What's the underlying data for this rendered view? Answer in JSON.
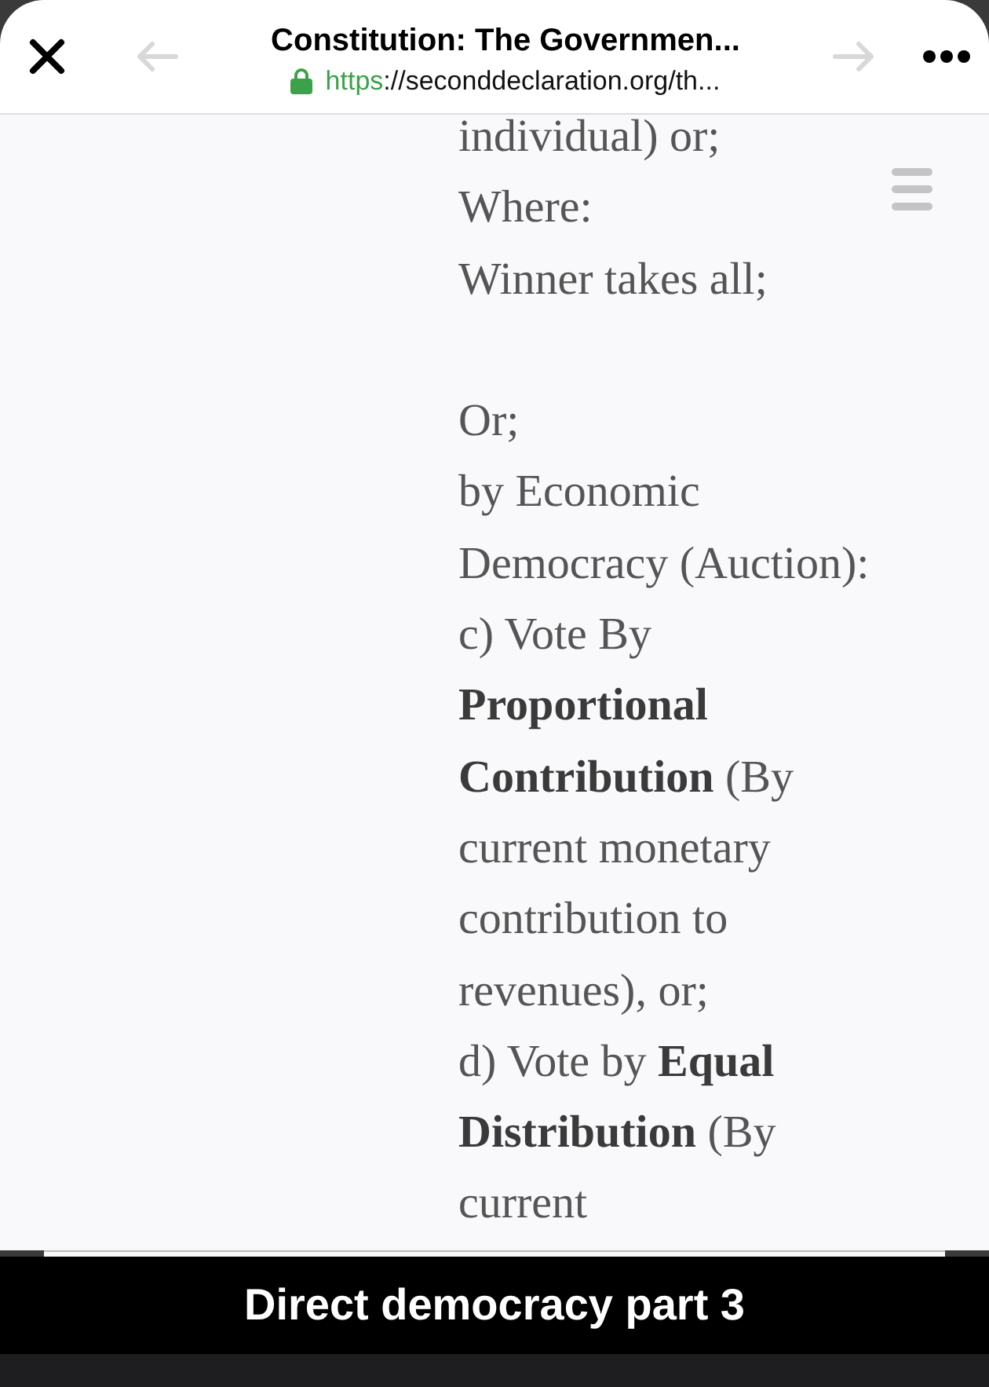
{
  "toolbar": {
    "title": "Constitution: The Governmen...",
    "url_scheme": "https",
    "url_rest": "://seconddeclaration.org/th...",
    "back_disabled": true,
    "forward_disabled": true
  },
  "article_lines": [
    {
      "kind": "text",
      "text": "individual) or;"
    },
    {
      "kind": "text",
      "text": "Where:"
    },
    {
      "kind": "text",
      "text": "Winner takes all;"
    },
    {
      "kind": "blank"
    },
    {
      "kind": "text",
      "text": "Or;"
    },
    {
      "kind": "text",
      "text": "by Economic"
    },
    {
      "kind": "text",
      "text": "Democracy (Auction):"
    },
    {
      "kind": "text",
      "text": "c) Vote By"
    },
    {
      "kind": "text",
      "text": "**Proportional**"
    },
    {
      "kind": "text",
      "text": "**Contribution** (By"
    },
    {
      "kind": "text",
      "text": "current monetary"
    },
    {
      "kind": "text",
      "text": "contribution to"
    },
    {
      "kind": "text",
      "text": "revenues),  or;"
    },
    {
      "kind": "text",
      "text": "d) Vote by **Equal**"
    },
    {
      "kind": "text",
      "text": "**Distribution** (By"
    },
    {
      "kind": "text",
      "text": "current"
    }
  ],
  "caption": "Direct democracy part 3"
}
